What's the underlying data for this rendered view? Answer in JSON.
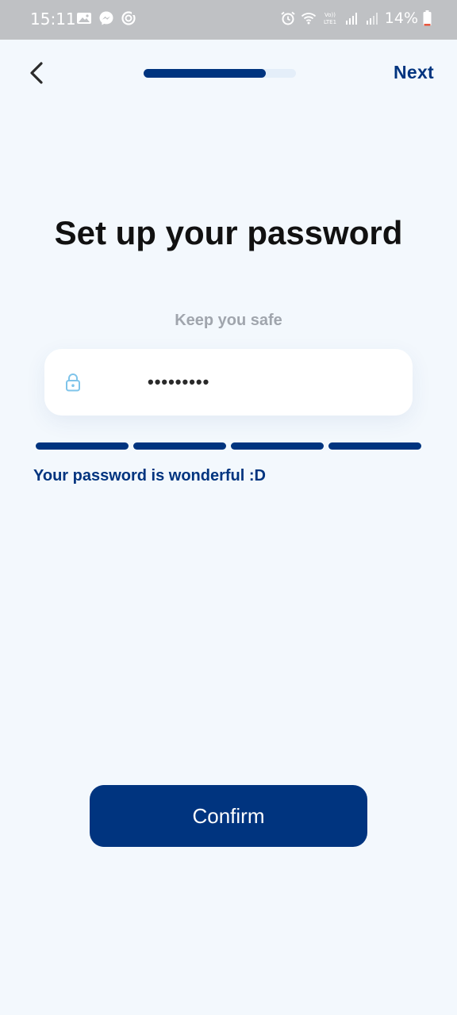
{
  "status_bar": {
    "time": "15:11",
    "left_icons": [
      "gallery-icon",
      "messenger-icon",
      "sync-icon"
    ],
    "right_icons": [
      "alarm-icon",
      "wifi-icon",
      "volte-icon",
      "signal-icon",
      "signal-icon"
    ],
    "battery_text": "14%",
    "battery_level": 0.14
  },
  "header": {
    "back_icon": "chevron-left-icon",
    "progress": 0.8,
    "next_label": "Next"
  },
  "main": {
    "title": "Set up your password",
    "subtitle": "Keep you safe",
    "password_field": {
      "icon": "lock-icon",
      "value": "•••••••••"
    },
    "strength": {
      "segments_filled": 4,
      "segments_total": 4,
      "message": "Your password is wonderful :D"
    },
    "confirm_label": "Confirm"
  },
  "colors": {
    "primary": "#00347f",
    "background": "#f3f8fd",
    "subtitle": "#a0a5ad",
    "lock_icon": "#7fc4ea"
  }
}
